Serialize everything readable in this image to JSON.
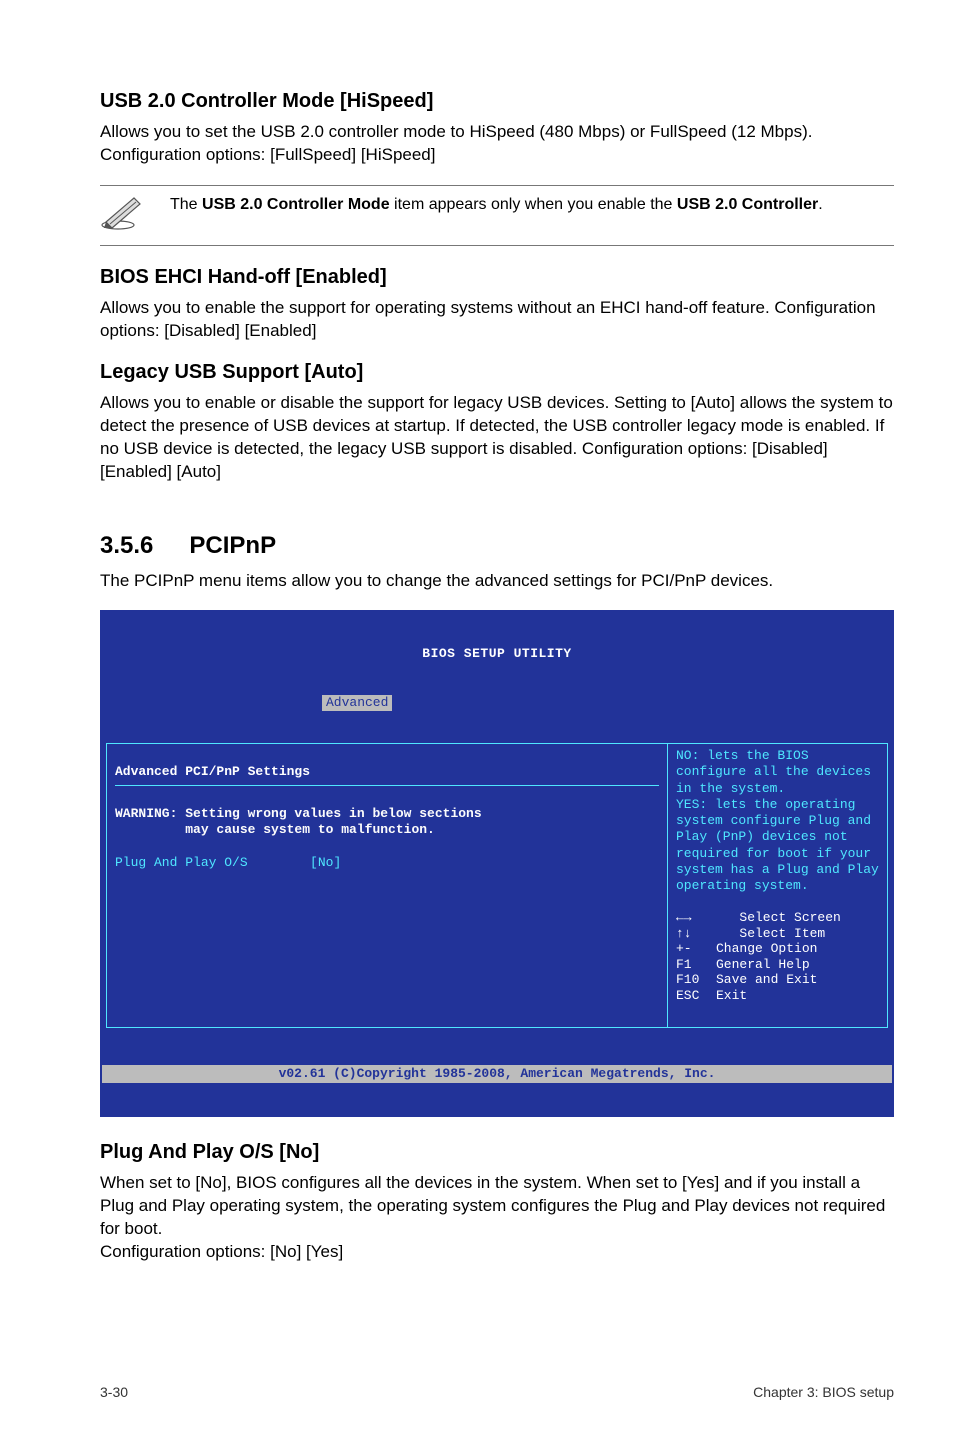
{
  "s1": {
    "title": "USB 2.0 Controller Mode [HiSpeed]",
    "body": "Allows you to set the USB 2.0 controller mode to HiSpeed (480 Mbps) or FullSpeed (12 Mbps). Configuration options: [FullSpeed] [HiSpeed]"
  },
  "note1": {
    "prefix": "The ",
    "bold1": "USB 2.0 Controller Mode",
    "mid": " item appears only when you enable the ",
    "bold2": "USB 2.0 Controller",
    "suffix": "."
  },
  "s2": {
    "title": "BIOS EHCI Hand-off [Enabled]",
    "body": "Allows you to enable the support for operating systems without an EHCI hand-off feature. Configuration options: [Disabled] [Enabled]"
  },
  "s3": {
    "title": "Legacy USB Support [Auto]",
    "body": "Allows you to enable or disable the support for legacy USB devices. Setting to [Auto] allows the system to detect the presence of USB devices at startup. If detected, the USB controller legacy mode is enabled. If no USB device is detected, the legacy USB support is disabled. Configuration options: [Disabled] [Enabled] [Auto]"
  },
  "sec356": {
    "num": "3.5.6",
    "title": "PCIPnP",
    "intro": "The PCIPnP menu items allow you to change the advanced settings for PCI/PnP devices."
  },
  "bios": {
    "title": "BIOS SETUP UTILITY",
    "active_tab": "Advanced",
    "left": {
      "heading": "Advanced PCI/PnP Settings",
      "warning_l1": "WARNING: Setting wrong values in below sections",
      "warning_l2": "         may cause system to malfunction.",
      "opt_label": "Plug And Play O/S",
      "opt_value": "[No]"
    },
    "right": {
      "help": "NO: lets the BIOS configure all the devices in the system.\nYES: lets the operating system configure Plug and Play (PnP) devices not required for boot if your system has a Plug and Play operating system.",
      "keys": {
        "k1": "Select Screen",
        "k2": "Select Item",
        "k3l": "+-",
        "k3": "Change Option",
        "k4l": "F1",
        "k4": "General Help",
        "k5l": "F10",
        "k5": "Save and Exit",
        "k6l": "ESC",
        "k6": "Exit"
      }
    },
    "footer": "v02.61 (C)Copyright 1985-2008, American Megatrends, Inc."
  },
  "s4": {
    "title": "Plug And Play O/S [No]",
    "body": "When set to [No], BIOS configures all the devices in the system. When set to [Yes] and if you install a Plug and Play operating system, the operating system configures the Plug and Play devices not required for boot.\nConfiguration options: [No] [Yes]"
  },
  "footer": {
    "left": "3-30",
    "right": "Chapter 3: BIOS setup"
  }
}
